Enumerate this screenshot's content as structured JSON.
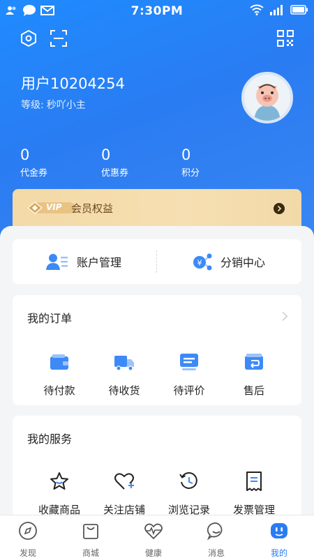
{
  "status_bar": {
    "time": "7:30PM"
  },
  "profile": {
    "username": "用户10204254",
    "level_label": "等级:",
    "level_value": "秒吖小主"
  },
  "stats": [
    {
      "value": "0",
      "label": "代金券"
    },
    {
      "value": "0",
      "label": "优惠券"
    },
    {
      "value": "0",
      "label": "积分"
    }
  ],
  "vip": {
    "badge": "VIP",
    "label": "会员权益"
  },
  "account": {
    "manage_label": "账户管理",
    "distribution_label": "分销中心"
  },
  "orders": {
    "title": "我的订单",
    "items": [
      {
        "label": "待付款",
        "icon": "wallet-icon"
      },
      {
        "label": "待收货",
        "icon": "truck-icon"
      },
      {
        "label": "待评价",
        "icon": "comment-icon"
      },
      {
        "label": "售后",
        "icon": "return-icon"
      }
    ]
  },
  "services": {
    "title": "我的服务",
    "items": [
      {
        "label": "收藏商品",
        "icon": "star-icon"
      },
      {
        "label": "关注店铺",
        "icon": "heart-plus-icon"
      },
      {
        "label": "浏览记录",
        "icon": "history-icon"
      },
      {
        "label": "发票管理",
        "icon": "invoice-icon"
      }
    ]
  },
  "tabbar": [
    {
      "label": "发现",
      "icon": "compass-icon"
    },
    {
      "label": "商城",
      "icon": "bag-icon"
    },
    {
      "label": "健康",
      "icon": "health-icon"
    },
    {
      "label": "消息",
      "icon": "message-icon"
    },
    {
      "label": "我的",
      "icon": "profile-icon",
      "active": true
    }
  ],
  "colors": {
    "primary": "#2a7cf2",
    "vip_gold": "#f3d9a6",
    "vip_text": "#6b4a21"
  }
}
